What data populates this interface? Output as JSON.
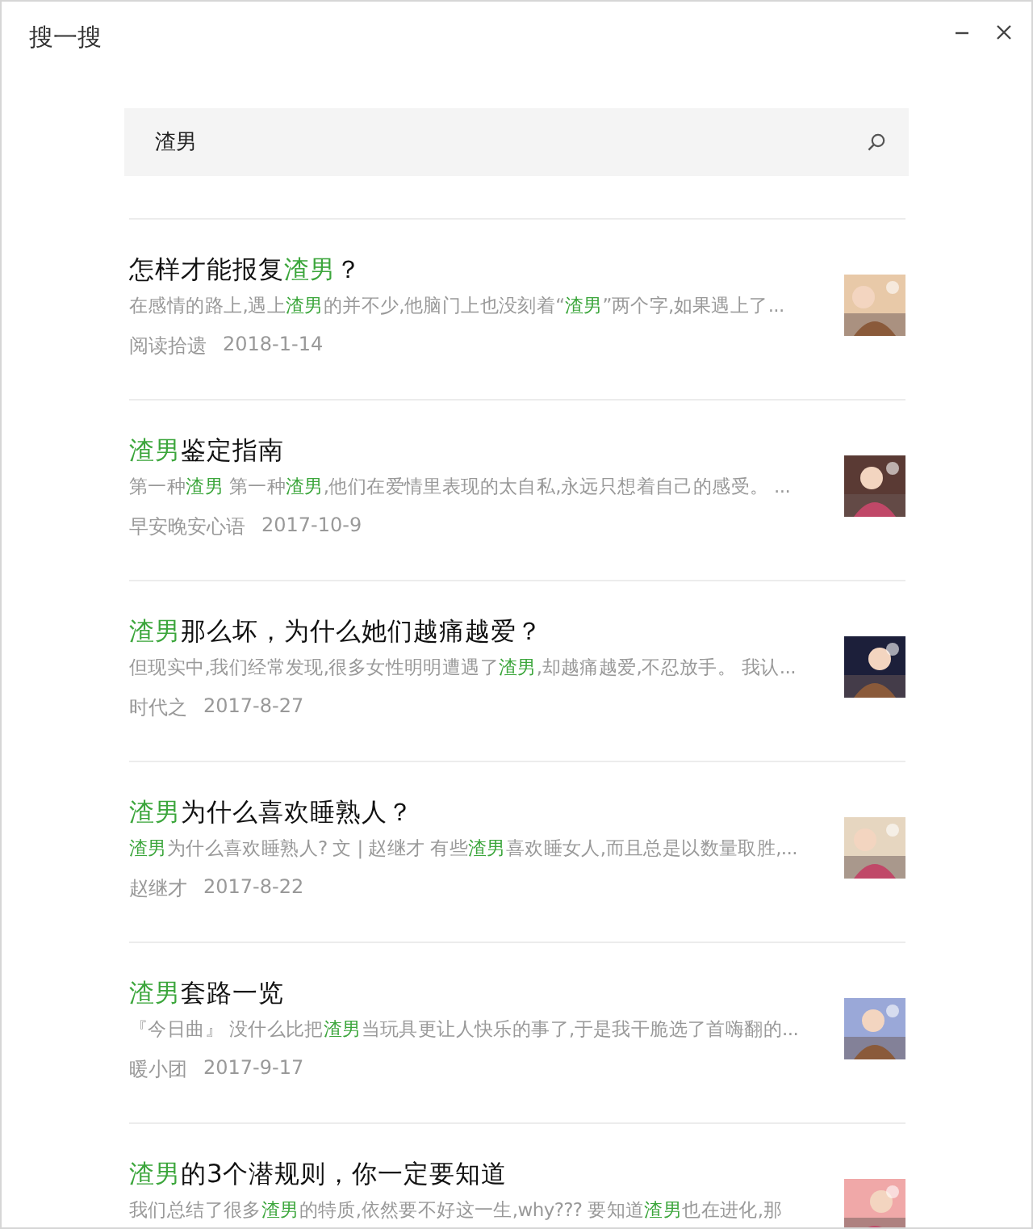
{
  "window": {
    "title": "搜一搜"
  },
  "search": {
    "value": "渣男"
  },
  "results": [
    {
      "title": [
        {
          "text": "怎样才能报复",
          "highlight": false
        },
        {
          "text": "渣男",
          "highlight": true
        },
        {
          "text": "？",
          "highlight": false
        }
      ],
      "snippet": [
        {
          "text": "在感情的路上,遇上",
          "highlight": false
        },
        {
          "text": "渣男",
          "highlight": true
        },
        {
          "text": "的并不少,他脑门上也没刻着“",
          "highlight": false
        },
        {
          "text": "渣男",
          "highlight": true
        },
        {
          "text": "”两个字,如果遇上了...",
          "highlight": false
        }
      ],
      "source": "阅读拾遗",
      "date": "2018-1-14"
    },
    {
      "title": [
        {
          "text": "渣男",
          "highlight": true
        },
        {
          "text": "鉴定指南",
          "highlight": false
        }
      ],
      "snippet": [
        {
          "text": "第一种",
          "highlight": false
        },
        {
          "text": "渣男",
          "highlight": true
        },
        {
          "text": " 第一种",
          "highlight": false
        },
        {
          "text": "渣男",
          "highlight": true
        },
        {
          "text": ",他们在爱情里表现的太自私,永远只想着自己的感受。 ...",
          "highlight": false
        }
      ],
      "source": "早安晚安心语",
      "date": "2017-10-9"
    },
    {
      "title": [
        {
          "text": "渣男",
          "highlight": true
        },
        {
          "text": "那么坏，为什么她们越痛越爱？",
          "highlight": false
        }
      ],
      "snippet": [
        {
          "text": "但现实中,我们经常发现,很多女性明明遭遇了",
          "highlight": false
        },
        {
          "text": "渣男",
          "highlight": true
        },
        {
          "text": ",却越痛越爱,不忍放手。 我认...",
          "highlight": false
        }
      ],
      "source": "时代之",
      "date": "2017-8-27"
    },
    {
      "title": [
        {
          "text": "渣男",
          "highlight": true
        },
        {
          "text": "为什么喜欢睡熟人？",
          "highlight": false
        }
      ],
      "snippet": [
        {
          "text": "渣男",
          "highlight": true
        },
        {
          "text": "为什么喜欢睡熟人? 文 | 赵继才 有些",
          "highlight": false
        },
        {
          "text": "渣男",
          "highlight": true
        },
        {
          "text": "喜欢睡女人,而且总是以数量取胜,...",
          "highlight": false
        }
      ],
      "source": "赵继才",
      "date": "2017-8-22"
    },
    {
      "title": [
        {
          "text": "渣男",
          "highlight": true
        },
        {
          "text": "套路一览",
          "highlight": false
        }
      ],
      "snippet": [
        {
          "text": "『今日曲』 没什么比把",
          "highlight": false
        },
        {
          "text": "渣男",
          "highlight": true
        },
        {
          "text": "当玩具更让人快乐的事了,于是我干脆选了首嗨翻的...",
          "highlight": false
        }
      ],
      "source": "暖小团",
      "date": "2017-9-17"
    },
    {
      "title": [
        {
          "text": "渣男",
          "highlight": true
        },
        {
          "text": "的3个潜规则，你一定要知道",
          "highlight": false
        }
      ],
      "snippet": [
        {
          "text": "我们总结了很多",
          "highlight": false
        },
        {
          "text": "渣男",
          "highlight": true
        },
        {
          "text": "的特质,依然要不好这一生,why??? 要知道",
          "highlight": false
        },
        {
          "text": "渣男",
          "highlight": true
        },
        {
          "text": "也在进化,那",
          "highlight": false
        }
      ]
    }
  ]
}
